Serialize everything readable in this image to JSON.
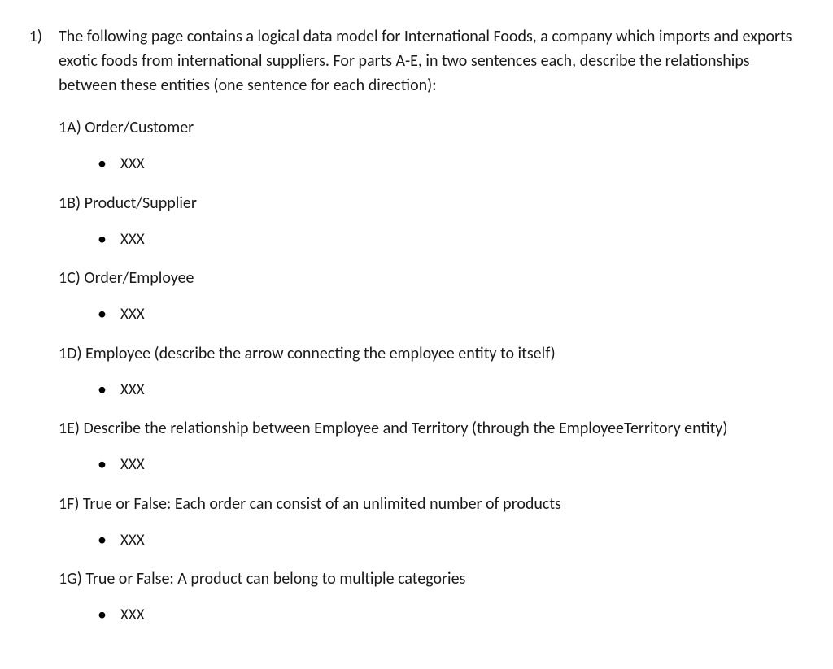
{
  "question_number": "1)",
  "intro": "The following page contains a logical data model for International Foods, a company which imports and exports exotic foods from international suppliers.  For parts A-E, in two sentences each, describe the relationships between these entities (one sentence for each direction):",
  "parts": {
    "a": {
      "label": "1A) Order/Customer",
      "bullet": "XXX"
    },
    "b": {
      "label": "1B) Product/Supplier",
      "bullet": "XXX"
    },
    "c": {
      "label": "1C) Order/Employee",
      "bullet": "XXX"
    },
    "d": {
      "label": "1D) Employee (describe the arrow connecting the employee entity to itself)",
      "bullet": "XXX"
    },
    "e": {
      "label": "1E) Describe the relationship between Employee and Territory (through the EmployeeTerritory entity)",
      "bullet": "XXX"
    },
    "f": {
      "label": "1F) True or False:  Each order can consist of an unlimited number of products",
      "bullet": "XXX"
    },
    "g": {
      "label": "1G) True or False:  A product can belong to multiple categories",
      "bullet": "XXX"
    }
  }
}
